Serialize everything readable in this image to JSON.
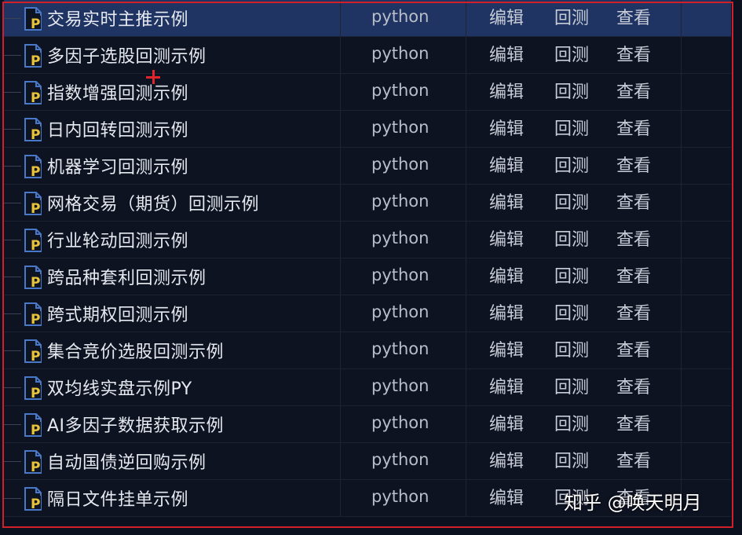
{
  "columns": {
    "language": "python",
    "actions": [
      "编辑",
      "回测",
      "查看"
    ]
  },
  "rows": [
    {
      "name": "交易实时主推示例",
      "language": "python",
      "selected": true
    },
    {
      "name": "多因子选股回测示例",
      "language": "python"
    },
    {
      "name": "指数增强回测示例",
      "language": "python"
    },
    {
      "name": "日内回转回测示例",
      "language": "python"
    },
    {
      "name": "机器学习回测示例",
      "language": "python"
    },
    {
      "name": "网格交易（期货）回测示例",
      "language": "python"
    },
    {
      "name": "行业轮动回测示例",
      "language": "python"
    },
    {
      "name": "跨品种套利回测示例",
      "language": "python"
    },
    {
      "name": "跨式期权回测示例",
      "language": "python"
    },
    {
      "name": "集合竞价选股回测示例",
      "language": "python"
    },
    {
      "name": "双均线实盘示例PY",
      "language": "python"
    },
    {
      "name": "AI多因子数据获取示例",
      "language": "python"
    },
    {
      "name": "自动国债逆回购示例",
      "language": "python"
    },
    {
      "name": "隔日文件挂单示例",
      "language": "python"
    }
  ],
  "watermark": "知乎 @唤天明月",
  "colors": {
    "background": "#0e1322",
    "selected_row": "#1f3463",
    "highlight_border": "#d2202a",
    "file_icon_blue": "#4a78c8",
    "file_icon_yellow": "#e9c33a"
  },
  "icons": {
    "file": "python-file-icon",
    "cursor": "crosshair-cursor-icon"
  }
}
